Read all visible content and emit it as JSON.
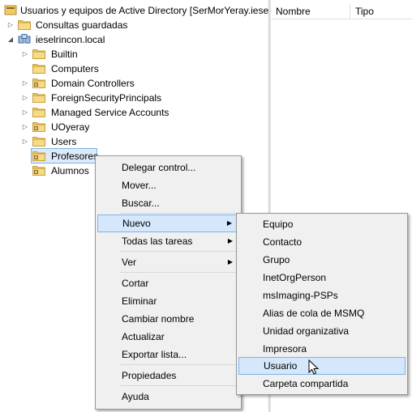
{
  "tree": {
    "root": "Usuarios y equipos de Active Directory [SerMorYeray.ieselrincon.local]",
    "saved_queries": "Consultas guardadas",
    "domain": "ieselrincon.local",
    "children": [
      "Builtin",
      "Computers",
      "Domain Controllers",
      "ForeignSecurityPrincipals",
      "Managed Service Accounts",
      "UOyeray",
      "Users",
      "Profesores",
      "Alumnos"
    ]
  },
  "list": {
    "columns": [
      "Nombre",
      "Tipo"
    ]
  },
  "context_menu": {
    "items": [
      "Delegar control...",
      "Mover...",
      "Buscar...",
      "Nuevo",
      "Todas las tareas",
      "Ver",
      "Cortar",
      "Eliminar",
      "Cambiar nombre",
      "Actualizar",
      "Exportar lista...",
      "Propiedades",
      "Ayuda"
    ]
  },
  "submenu": {
    "items": [
      "Equipo",
      "Contacto",
      "Grupo",
      "InetOrgPerson",
      "msImaging-PSPs",
      "Alias de cola de MSMQ",
      "Unidad organizativa",
      "Impresora",
      "Usuario",
      "Carpeta compartida"
    ]
  },
  "colors": {
    "selection": "#dcebfc",
    "menu_hover": "#d5e7fa",
    "folder": "#f1c965"
  }
}
